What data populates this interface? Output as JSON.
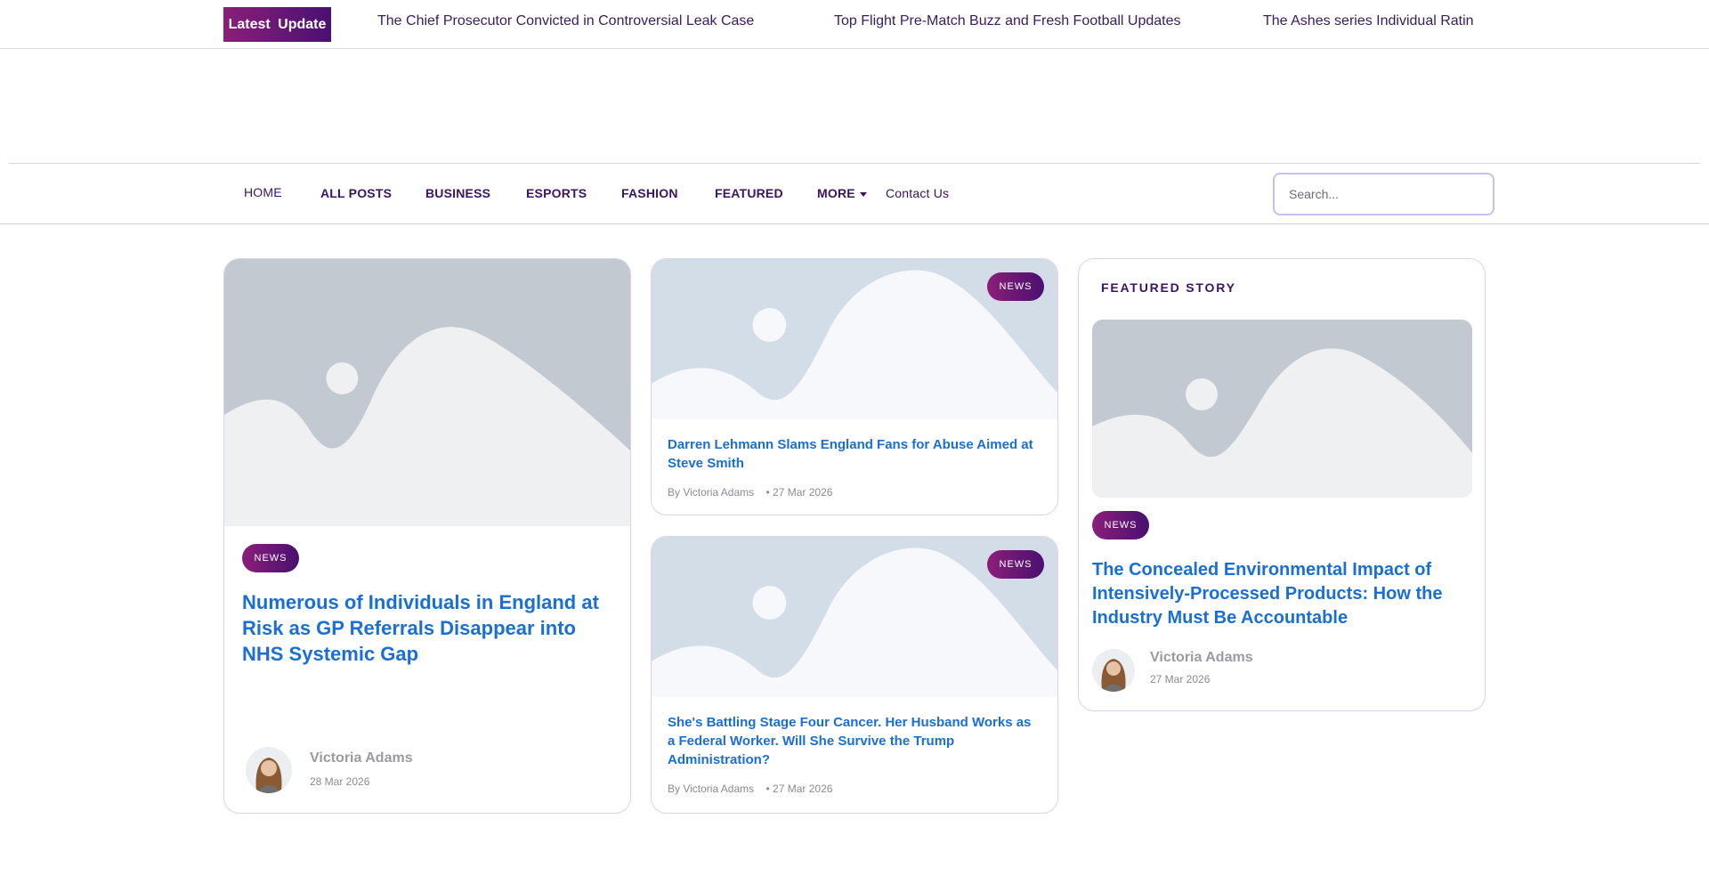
{
  "ticker": {
    "label": "Latest Update",
    "items": [
      "The Chief Prosecutor Convicted in Controversial Leak Case",
      "Top Flight Pre-Match Buzz and Fresh Football Updates",
      "The Ashes series Individual Ratin"
    ]
  },
  "nav": {
    "items": [
      "HOME",
      "ALL POSTS",
      "BUSINESS",
      "ESPORTS",
      "FASHION",
      "FEATURED",
      "MORE"
    ],
    "contact": "Contact Us",
    "search_placeholder": "Search..."
  },
  "colors": {
    "accent_start": "#8a1f7a",
    "accent_end": "#4a1070",
    "link": "#1a6fd4",
    "nav_text": "#3a1463"
  },
  "main_card": {
    "badge": "News",
    "title": "Numerous of Individuals in England at Risk as GP Referrals Disappear into NHS Systemic Gap",
    "author": "Victoria Adams",
    "date": "28 Mar 2026"
  },
  "small_cards": [
    {
      "badge": "News",
      "title": "Darren Lehmann Slams England Fans for Abuse Aimed at Steve Smith",
      "byline": "By Victoria Adams",
      "date": "• 27 Mar 2026"
    },
    {
      "badge": "News",
      "title": "She's Battling Stage Four Cancer. Her Husband Works as a Federal Worker. Will She Survive the Trump Administration?",
      "byline": "By Victoria Adams",
      "date": "• 27 Mar 2026"
    }
  ],
  "featured": {
    "label": "Featured Story",
    "badge": "News",
    "title": "The Concealed Environmental Impact of Intensively-Processed Products: How the Industry Must Be Accountable",
    "author": "Victoria Adams",
    "date": "27 Mar 2026"
  }
}
